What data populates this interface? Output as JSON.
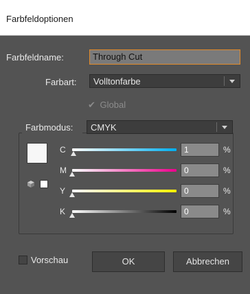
{
  "window": {
    "title": "Farbfeldoptionen"
  },
  "fields": {
    "name_label": "Farbfeldname:",
    "name_value": "Through Cut",
    "type_label": "Farbart:",
    "type_value": "Volltonfarbe",
    "global_label": "Global",
    "global_checked": true,
    "global_enabled": false
  },
  "color_mode": {
    "label": "Farbmodus:",
    "value": "CMYK"
  },
  "sliders": [
    {
      "label": "C",
      "value": "1",
      "unit": "%",
      "gradient": [
        "#ffffff",
        "#00aeef"
      ]
    },
    {
      "label": "M",
      "value": "0",
      "unit": "%",
      "gradient": [
        "#ffffff",
        "#ec008c"
      ]
    },
    {
      "label": "Y",
      "value": "0",
      "unit": "%",
      "gradient": [
        "#ffffff",
        "#fff200"
      ]
    },
    {
      "label": "K",
      "value": "0",
      "unit": "%",
      "gradient": [
        "#ffffff",
        "#000000"
      ]
    }
  ],
  "footer": {
    "preview_label": "Vorschau",
    "preview_checked": false,
    "ok_label": "OK",
    "cancel_label": "Abbrechen"
  },
  "colors": {
    "accent_focus": "#e38b2a",
    "panel_bg": "#535353",
    "swatch": "#f7f7f7"
  }
}
